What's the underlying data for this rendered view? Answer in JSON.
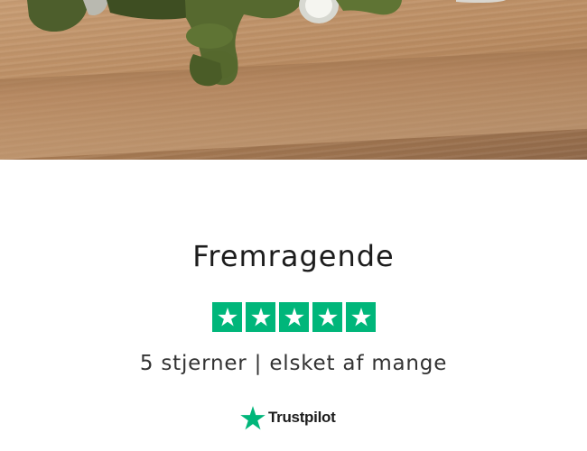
{
  "hero": {
    "image_alt": ""
  },
  "review": {
    "title": "Fremragende",
    "subtitle": "5 stjerner | elsket af mange",
    "rating": 5,
    "star_count": 5,
    "star_color": "#00b67a",
    "star_glyph_color": "#ffffff"
  },
  "trustpilot": {
    "label": "Trustpilot",
    "star_color": "#00b67a"
  }
}
